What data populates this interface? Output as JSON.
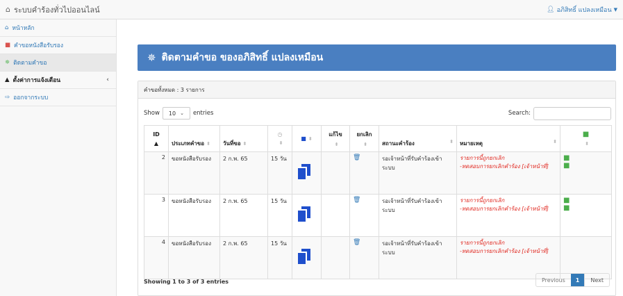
{
  "navbar": {
    "title": "ระบบคำร้องทั่วไปออนไลน์",
    "user": "อภิสิทธิ์ แปลงเหมือน"
  },
  "sidebar": {
    "items": [
      {
        "label": "หน้าหลัก",
        "icon": "home-icon"
      },
      {
        "label": "คำขอหนังสือรับรอง",
        "icon": "file-pdf-icon"
      },
      {
        "label": "ติดตามคำขอ",
        "icon": "spinner-icon"
      },
      {
        "label": "ตั้งค่าการแจ้งเตือน",
        "icon": "bell-icon"
      },
      {
        "label": "ออกจากระบบ",
        "icon": "sign-out-icon"
      }
    ]
  },
  "main": {
    "title": "ติดตามคำขอ ของอภิสิทธิ์ แปลงเหมือน",
    "panel_heading": "คำขอทั้งหมด : 3 รายการ",
    "show_label": "Show",
    "show_value": "10",
    "entries_label": "entries",
    "search_label": "Search:",
    "search_value": "",
    "columns": {
      "id": "ID",
      "type": "ประเภทคำขอ",
      "date": "วันที่ขอ",
      "edit": "แก้ไข",
      "cancel": "ยกเลิก",
      "status": "สถานะคำร้อง",
      "note": "หมายเหตุ"
    },
    "rows": [
      {
        "id": "2",
        "type": "ขอหนังสือรับรอง",
        "date": "2 ก.พ. 65",
        "days": "15 วัน",
        "status": "รอเจ้าหน้าที่รับคำร้องเข้าระบบ",
        "note1": "รายการนี้ถูกยกเลิก",
        "note2": "-ทดสอบการยกเลิกคำร้อง [เจ้าหน้าที่]"
      },
      {
        "id": "3",
        "type": "ขอหนังสือรับรอง",
        "date": "2 ก.พ. 65",
        "days": "15 วัน",
        "status": "รอเจ้าหน้าที่รับคำร้องเข้าระบบ",
        "note1": "รายการนี้ถูกยกเลิก",
        "note2": "-ทดสอบการยกเลิกคำร้อง [เจ้าหน้าที่]"
      },
      {
        "id": "4",
        "type": "ขอหนังสือรับรอง",
        "date": "2 ก.พ. 65",
        "days": "15 วัน",
        "status": "รอเจ้าหน้าที่รับคำร้องเข้าระบบ",
        "note1": "รายการนี้ถูกยกเลิก",
        "note2": "-ทดสอบการยกเลิกคำร้อง [เจ้าหน้าที่]"
      }
    ],
    "info": "Showing 1 to 3 of 3 entries",
    "pager": {
      "previous": "Previous",
      "current": "1",
      "next": "Next"
    }
  },
  "colors": {
    "accent": "#4a7fc1",
    "link": "#337ab7",
    "danger": "#e0261e",
    "excel": "#4cae4c"
  }
}
